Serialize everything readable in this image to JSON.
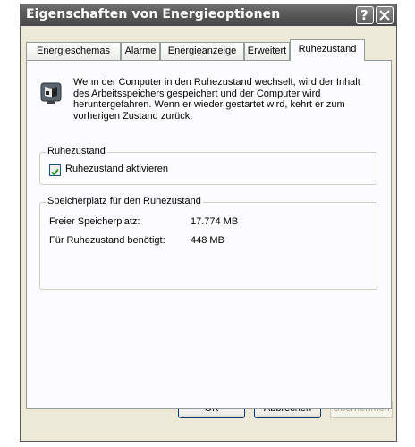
{
  "window": {
    "title": "Eigenschaften von Energieoptionen",
    "help_label": "?"
  },
  "tabs": [
    {
      "label": "Energieschemas"
    },
    {
      "label": "Alarme"
    },
    {
      "label": "Energieanzeige"
    },
    {
      "label": "Erweitert"
    },
    {
      "label": "Ruhezustand",
      "active": true
    }
  ],
  "info": {
    "icon": "hibernate-monitor-icon",
    "text": "Wenn der Computer in den Ruhezustand wechselt, wird der Inhalt des Arbeitsspeichers gespeichert und der Computer wird heruntergefahren. Wenn er wieder gestartet wird, kehrt er zum vorherigen Zustand zurück."
  },
  "hibernate": {
    "legend": "Ruhezustand",
    "checkbox_label": "Ruhezustand aktivieren",
    "checked": true
  },
  "storage": {
    "legend": "Speicherplatz für den Ruhezustand",
    "free_label": "Freier Speicherplatz:",
    "free_value": "17.774 MB",
    "needed_label": "Für Ruhezustand benötigt:",
    "needed_value": "448 MB"
  },
  "buttons": {
    "ok": "OK",
    "cancel": "Abbrechen",
    "apply": "Übernehmen"
  },
  "colors": {
    "dialog_bg": "#ece9d8",
    "titlebar": "#5a5a5a",
    "panel_bg": "#fcfcfe"
  }
}
